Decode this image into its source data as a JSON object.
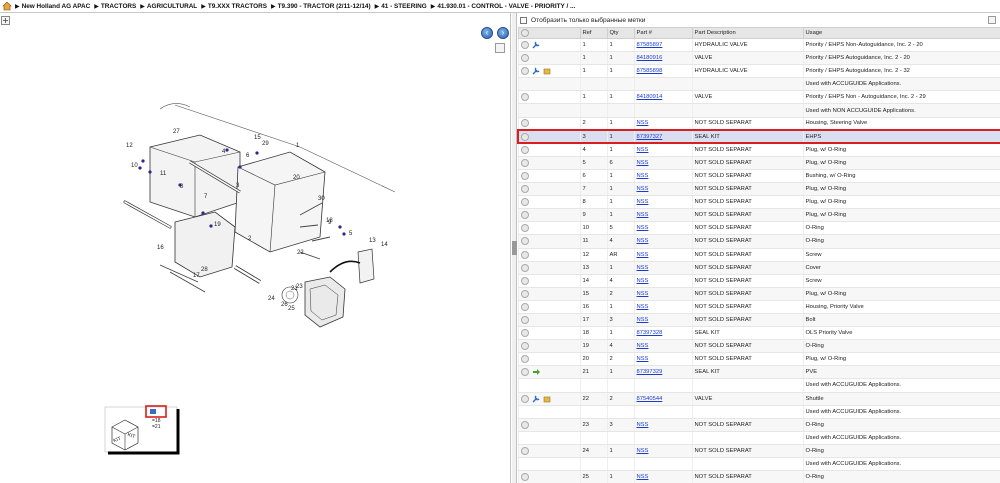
{
  "breadcrumb": [
    "New Holland AG APAC",
    "TRACTORS",
    "AGRICULTURAL",
    "T9.XXX TRACTORS",
    "T9.390 - TRACTOR (2/11-12/14)",
    "41 - STEERING",
    "41.930.01 - CONTROL - VALVE - PRIORITY / ..."
  ],
  "filter_label": "Отобразить только выбранные метки",
  "columns": [
    "",
    "Ref",
    "Qty",
    "Part #",
    "Part Description",
    "Usage"
  ],
  "rows": [
    {
      "icons": [
        "info",
        "wrench"
      ],
      "ref": "1",
      "qty": "1",
      "part": "87585897",
      "desc": "HYDRAULIC VALVE",
      "usage": "Priority / EHPS Non-Autoguidance, Inc. 2 - 20"
    },
    {
      "icons": [
        "info"
      ],
      "ref": "1",
      "qty": "1",
      "part": "84180916",
      "desc": "VALVE",
      "usage": "Priority / EHPS Autoguidance, Inc. 2 - 20"
    },
    {
      "icons": [
        "info",
        "wrench",
        "box"
      ],
      "ref": "1",
      "qty": "1",
      "part": "87585898",
      "desc": "HYDRAULIC VALVE",
      "usage": "Priority / EHPS Autoguidance, Inc. 2 - 32"
    },
    {
      "icons": [],
      "ref": "",
      "qty": "",
      "part": "",
      "desc": "",
      "usage": "Used with ACCUGUIDE Applications."
    },
    {
      "icons": [
        "info"
      ],
      "ref": "1",
      "qty": "1",
      "part": "84180914",
      "desc": "VALVE",
      "usage": "Priority / EHPS Non - Autoguidance, Inc. 2 - 29"
    },
    {
      "icons": [],
      "ref": "",
      "qty": "",
      "part": "",
      "desc": "",
      "usage": "Used with NON ACCUGUIDE Applications."
    },
    {
      "icons": [
        "info"
      ],
      "ref": "2",
      "qty": "1",
      "part": "NSS",
      "desc": "NOT SOLD SEPARAT",
      "usage": "Housing, Steering Valve"
    },
    {
      "icons": [
        "info"
      ],
      "ref": "3",
      "qty": "1",
      "part": "87397327",
      "desc": "SEAL KIT",
      "usage": "EHPS",
      "selected": true
    },
    {
      "icons": [
        "info"
      ],
      "ref": "4",
      "qty": "1",
      "part": "NSS",
      "desc": "NOT SOLD SEPARAT",
      "usage": "Plug, w/ O-Ring"
    },
    {
      "icons": [
        "info"
      ],
      "ref": "5",
      "qty": "6",
      "part": "NSS",
      "desc": "NOT SOLD SEPARAT",
      "usage": "Plug, w/ O-Ring"
    },
    {
      "icons": [
        "info"
      ],
      "ref": "6",
      "qty": "1",
      "part": "NSS",
      "desc": "NOT SOLD SEPARAT",
      "usage": "Bushing, w/ O-Ring"
    },
    {
      "icons": [
        "info"
      ],
      "ref": "7",
      "qty": "1",
      "part": "NSS",
      "desc": "NOT SOLD SEPARAT",
      "usage": "Plug, w/ O-Ring"
    },
    {
      "icons": [
        "info"
      ],
      "ref": "8",
      "qty": "1",
      "part": "NSS",
      "desc": "NOT SOLD SEPARAT",
      "usage": "Plug, w/ O-Ring"
    },
    {
      "icons": [
        "info"
      ],
      "ref": "9",
      "qty": "1",
      "part": "NSS",
      "desc": "NOT SOLD SEPARAT",
      "usage": "Plug, w/ O-Ring"
    },
    {
      "icons": [
        "info"
      ],
      "ref": "10",
      "qty": "5",
      "part": "NSS",
      "desc": "NOT SOLD SEPARAT",
      "usage": "O-Ring"
    },
    {
      "icons": [
        "info"
      ],
      "ref": "11",
      "qty": "4",
      "part": "NSS",
      "desc": "NOT SOLD SEPARAT",
      "usage": "O-Ring"
    },
    {
      "icons": [
        "info"
      ],
      "ref": "12",
      "qty": "AR",
      "part": "NSS",
      "desc": "NOT SOLD SEPARAT",
      "usage": "Screw"
    },
    {
      "icons": [
        "info"
      ],
      "ref": "13",
      "qty": "1",
      "part": "NSS",
      "desc": "NOT SOLD SEPARAT",
      "usage": "Cover"
    },
    {
      "icons": [
        "info"
      ],
      "ref": "14",
      "qty": "4",
      "part": "NSS",
      "desc": "NOT SOLD SEPARAT",
      "usage": "Screw"
    },
    {
      "icons": [
        "info"
      ],
      "ref": "15",
      "qty": "2",
      "part": "NSS",
      "desc": "NOT SOLD SEPARAT",
      "usage": "Plug, w/ O-Ring"
    },
    {
      "icons": [
        "info"
      ],
      "ref": "16",
      "qty": "1",
      "part": "NSS",
      "desc": "NOT SOLD SEPARAT",
      "usage": "Housing, Priority Valve"
    },
    {
      "icons": [
        "info"
      ],
      "ref": "17",
      "qty": "3",
      "part": "NSS",
      "desc": "NOT SOLD SEPARAT",
      "usage": "Bolt"
    },
    {
      "icons": [
        "info"
      ],
      "ref": "18",
      "qty": "1",
      "part": "87397328",
      "desc": "SEAL KIT",
      "usage": "OLS Priority Valve"
    },
    {
      "icons": [
        "info"
      ],
      "ref": "19",
      "qty": "4",
      "part": "NSS",
      "desc": "NOT SOLD SEPARAT",
      "usage": "O-Ring"
    },
    {
      "icons": [
        "info"
      ],
      "ref": "20",
      "qty": "2",
      "part": "NSS",
      "desc": "NOT SOLD SEPARAT",
      "usage": "Plug, w/ O-Ring"
    },
    {
      "icons": [
        "arrow"
      ],
      "ref": "21",
      "qty": "1",
      "part": "87397329",
      "desc": "SEAL KIT",
      "usage": "PVE"
    },
    {
      "icons": [],
      "ref": "",
      "qty": "",
      "part": "",
      "desc": "",
      "usage": "Used with ACCUGUIDE Applications."
    },
    {
      "icons": [
        "info",
        "wrench",
        "box"
      ],
      "ref": "22",
      "qty": "2",
      "part": "87540544",
      "desc": "VALVE",
      "usage": "Shuttle"
    },
    {
      "icons": [],
      "ref": "",
      "qty": "",
      "part": "",
      "desc": "",
      "usage": "Used with ACCUGUIDE Applications."
    },
    {
      "icons": [
        "info"
      ],
      "ref": "23",
      "qty": "3",
      "part": "NSS",
      "desc": "NOT SOLD SEPARAT",
      "usage": "O-Ring"
    },
    {
      "icons": [],
      "ref": "",
      "qty": "",
      "part": "",
      "desc": "",
      "usage": "Used with ACCUGUIDE Applications."
    },
    {
      "icons": [
        "info"
      ],
      "ref": "24",
      "qty": "1",
      "part": "NSS",
      "desc": "NOT SOLD SEPARAT",
      "usage": "O-Ring"
    },
    {
      "icons": [],
      "ref": "",
      "qty": "",
      "part": "",
      "desc": "",
      "usage": "Used with ACCUGUIDE Applications."
    },
    {
      "icons": [
        "info"
      ],
      "ref": "25",
      "qty": "1",
      "part": "NSS",
      "desc": "NOT SOLD SEPARAT",
      "usage": "O-Ring"
    }
  ],
  "diagram": {
    "callouts": [
      "1",
      "2",
      "3",
      "4",
      "5",
      "6",
      "7",
      "8",
      "9",
      "10",
      "11",
      "12",
      "13",
      "14",
      "15",
      "16",
      "17",
      "18",
      "19",
      "20",
      "21",
      "22",
      "23",
      "24",
      "25",
      "26",
      "27",
      "28",
      "29",
      "30"
    ],
    "kit_text": "KIT",
    "kit_legend": [
      "=18",
      "=21"
    ]
  },
  "colors": {
    "selection": "#d81e1e",
    "link": "#1a3ccc",
    "nav": "#2b64b8"
  }
}
